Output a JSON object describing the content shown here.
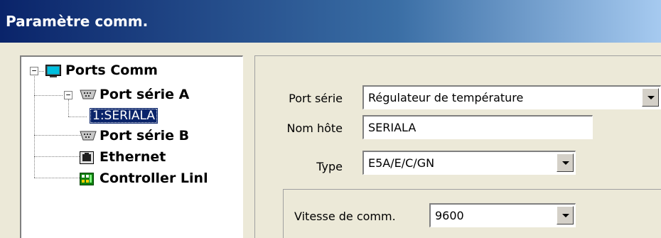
{
  "window": {
    "title": "Paramètre comm."
  },
  "tree": {
    "root": {
      "label": "Ports Comm",
      "icon": "monitor-icon",
      "expander": "−"
    },
    "port_a": {
      "label": "Port série A",
      "icon": "serial-port-icon",
      "expander": "−"
    },
    "port_a_child": {
      "label": "1:SERIALA",
      "selected": true
    },
    "port_b": {
      "label": "Port série B",
      "icon": "serial-port-icon"
    },
    "ethernet": {
      "label": "Ethernet",
      "icon": "ethernet-port-icon"
    },
    "controller_link": {
      "label": "Controller Linl",
      "icon": "controller-link-icon"
    }
  },
  "form": {
    "port_serie": {
      "label": "Port série",
      "value": "Régulateur de température"
    },
    "nom_hote": {
      "label": "Nom hôte",
      "value": "SERIALA"
    },
    "type": {
      "label": "Type",
      "value": "E5A/E/C/GN"
    },
    "vitesse": {
      "label": "Vitesse de comm.",
      "value": "9600"
    }
  }
}
